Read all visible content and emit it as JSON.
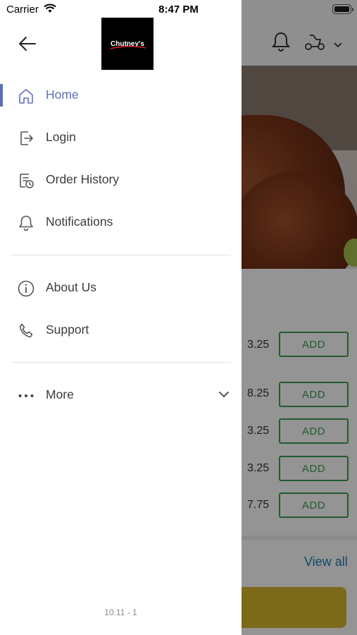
{
  "status_bar": {
    "carrier": "Carrier",
    "time": "8:47 PM"
  },
  "drawer": {
    "logo_text": "Chutney's",
    "menu": [
      {
        "label": "Home",
        "icon": "home-icon",
        "active": true
      },
      {
        "label": "Login",
        "icon": "login-icon"
      },
      {
        "label": "Order History",
        "icon": "order-history-icon"
      },
      {
        "label": "Notifications",
        "icon": "bell-icon"
      },
      {
        "label": "About Us",
        "icon": "info-icon"
      },
      {
        "label": "Support",
        "icon": "phone-icon"
      },
      {
        "label": "More",
        "icon": "more-dots-icon"
      }
    ],
    "version": "10.11 - 1"
  },
  "background": {
    "prices": [
      "3.25",
      "8.25",
      "3.25",
      "3.25",
      "7.75"
    ],
    "add_label": "ADD",
    "view_all": "View all"
  },
  "colors": {
    "accent": "#5b6fbb",
    "add_green": "#3a9d52",
    "link_blue": "#1f7fb0",
    "bottom_bar": "#d8b52e"
  }
}
